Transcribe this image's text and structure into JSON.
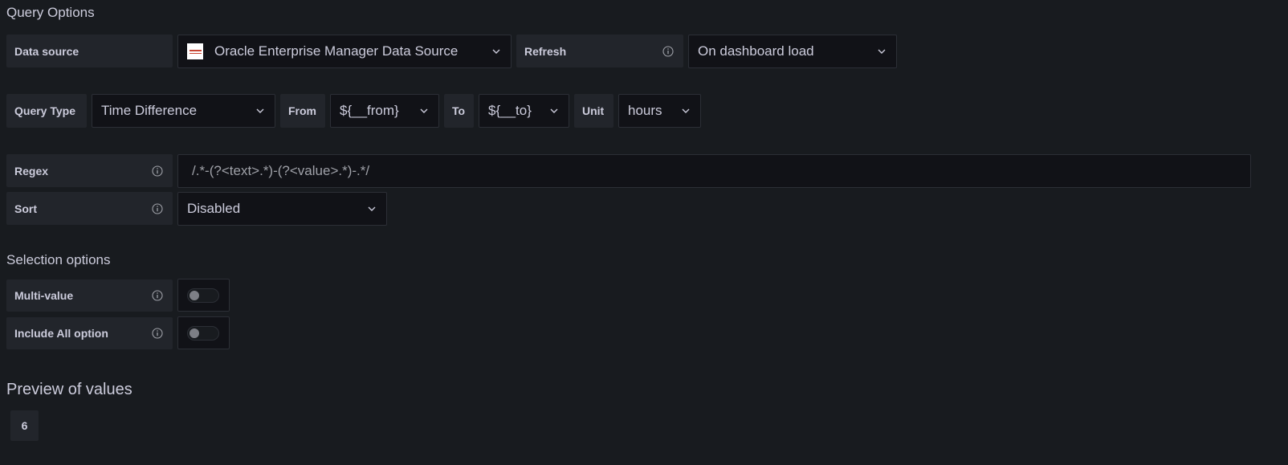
{
  "query_options": {
    "title": "Query Options",
    "data_source": {
      "label": "Data source",
      "value": "Oracle Enterprise Manager Data Source"
    },
    "refresh": {
      "label": "Refresh",
      "value": "On dashboard load"
    },
    "query_type": {
      "label": "Query Type",
      "value": "Time Difference"
    },
    "from": {
      "label": "From",
      "value": "${__from}"
    },
    "to": {
      "label": "To",
      "value": "${__to}"
    },
    "unit": {
      "label": "Unit",
      "value": "hours"
    },
    "regex": {
      "label": "Regex",
      "value": "/.*-(?<text>.*)-(?<value>.*)-.*/"
    },
    "sort": {
      "label": "Sort",
      "value": "Disabled"
    }
  },
  "selection_options": {
    "title": "Selection options",
    "multi_value": {
      "label": "Multi-value",
      "enabled": false
    },
    "include_all": {
      "label": "Include All option",
      "enabled": false
    }
  },
  "preview": {
    "title": "Preview of values",
    "values": [
      "6"
    ]
  },
  "colors": {
    "background": "#181b1f",
    "label_bg": "#22252b",
    "field_bg": "#111217",
    "border": "#2c2f36",
    "text": "#ccccdc"
  }
}
